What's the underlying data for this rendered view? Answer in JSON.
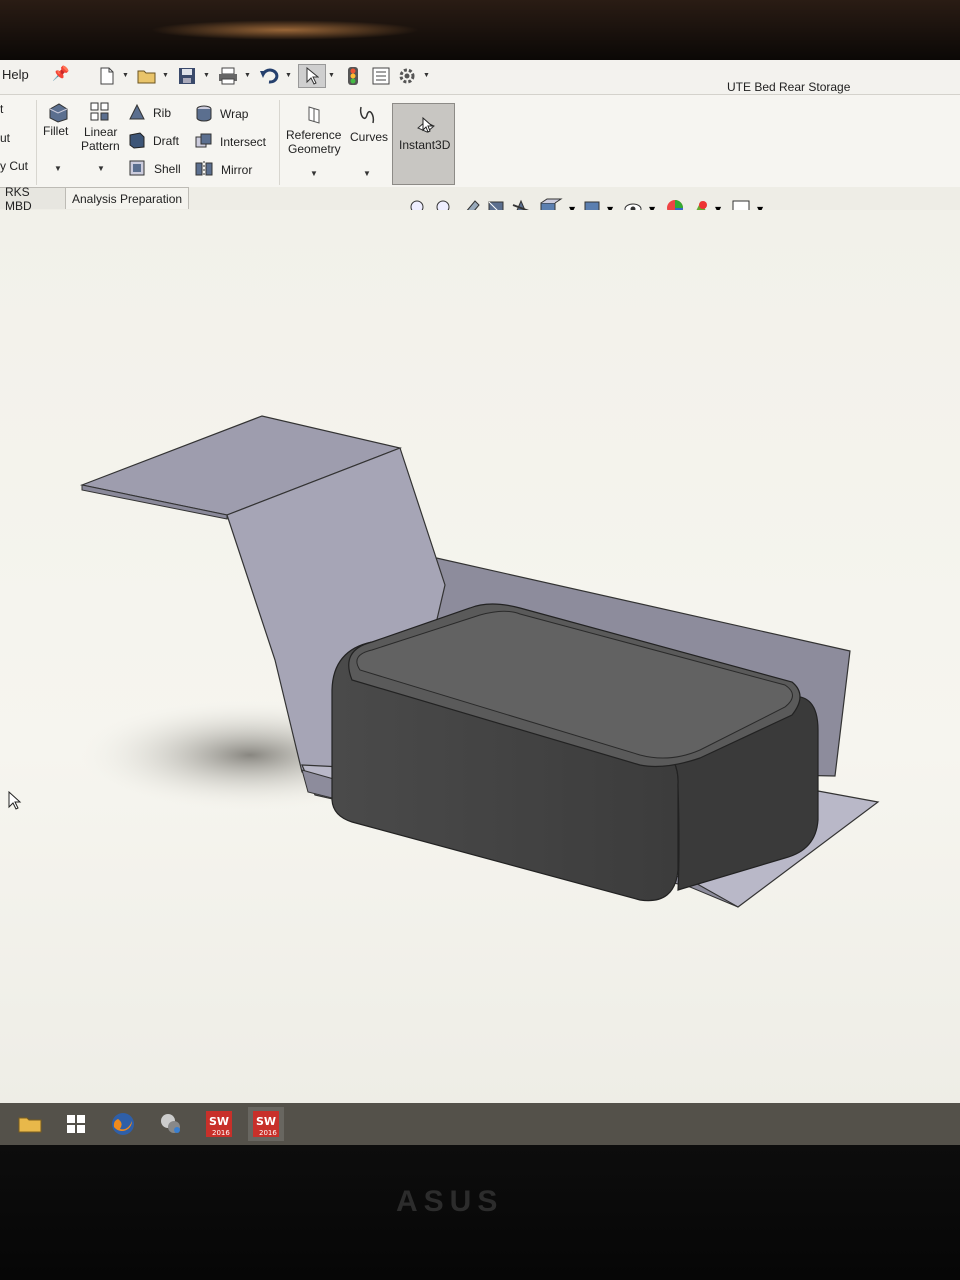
{
  "window": {
    "document_title": "UTE Bed Rear Storage"
  },
  "menu": {
    "help": "Help"
  },
  "quick_access": {
    "items": [
      {
        "icon": "new-document-icon"
      },
      {
        "icon": "open-folder-icon"
      },
      {
        "icon": "save-icon"
      },
      {
        "icon": "print-icon"
      },
      {
        "icon": "undo-icon"
      },
      {
        "icon": "select-arrow-icon"
      },
      {
        "icon": "rebuild-traffic-light-icon"
      },
      {
        "icon": "file-properties-icon"
      },
      {
        "icon": "options-gear-icon"
      }
    ]
  },
  "ribbon": {
    "left_cut": {
      "line1": "t",
      "line2": "ut",
      "line3": "y Cut"
    },
    "fillet": "Fillet",
    "linear_pattern": {
      "line1": "Linear",
      "line2": "Pattern"
    },
    "rib": "Rib",
    "draft": "Draft",
    "shell": "Shell",
    "wrap": "Wrap",
    "intersect": "Intersect",
    "mirror": "Mirror",
    "reference_geometry": {
      "line1": "Reference",
      "line2": "Geometry"
    },
    "curves": "Curves",
    "instant3d": "Instant3D"
  },
  "tabs": [
    {
      "label": "RKS MBD"
    },
    {
      "label": "Analysis Preparation"
    }
  ],
  "heads_up_toolbar": [
    "zoom-to-fit-icon",
    "zoom-to-area-icon",
    "previous-view-icon",
    "section-view-icon",
    "dynamic-annotation-icon",
    "view-orientation-icon",
    "display-style-icon",
    "hide-show-items-icon",
    "edit-appearance-icon",
    "apply-scene-icon",
    "view-settings-icon"
  ],
  "taskbar": [
    {
      "icon": "file-explorer-icon"
    },
    {
      "icon": "store-icon"
    },
    {
      "icon": "firefox-icon"
    },
    {
      "icon": "app-icon"
    },
    {
      "icon": "solidworks-2016-icon",
      "label": "2016"
    },
    {
      "icon": "solidworks-2016-icon",
      "label": "2016"
    }
  ],
  "monitor": {
    "brand": "ASUS"
  }
}
